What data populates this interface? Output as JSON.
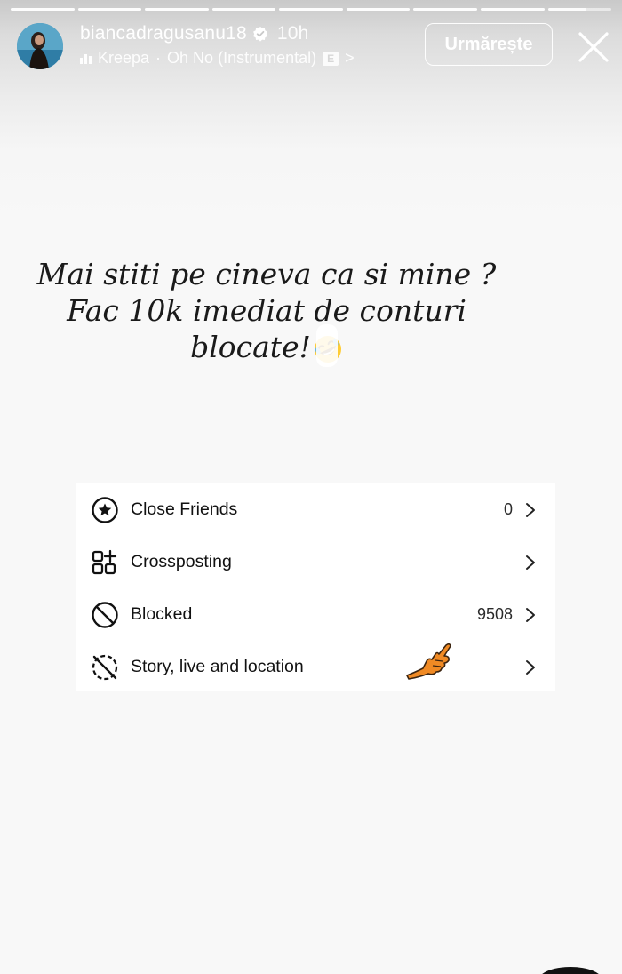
{
  "header": {
    "username": "biancadragusanu18",
    "time": "10h",
    "music": {
      "artist": "Kreepa",
      "separator": "·",
      "track": "Oh No (Instrumental)",
      "explicit_badge": "E",
      "chevron": ">"
    },
    "follow_label": "Urmărește",
    "progress_segments": 9,
    "current_segment": 9
  },
  "caption": {
    "line1": "Mai stiti pe cineva ca si mine ?",
    "line2": "Fac 10k imediat de conturi",
    "line3": "blocate!"
  },
  "settings": {
    "rows": [
      {
        "label": "Close Friends",
        "count": "0",
        "icon": "star-circle-icon"
      },
      {
        "label": "Crossposting",
        "count": "",
        "icon": "grid-plus-icon"
      },
      {
        "label": "Blocked",
        "count": "9508",
        "icon": "blocked-icon"
      },
      {
        "label": "Story, live and location",
        "count": "",
        "icon": "story-off-icon"
      }
    ]
  },
  "colors": {
    "text_dark": "#111111",
    "panel_bg": "#ffffff",
    "background": "#f8f8f8",
    "pointer_orange": "#f08a24"
  }
}
